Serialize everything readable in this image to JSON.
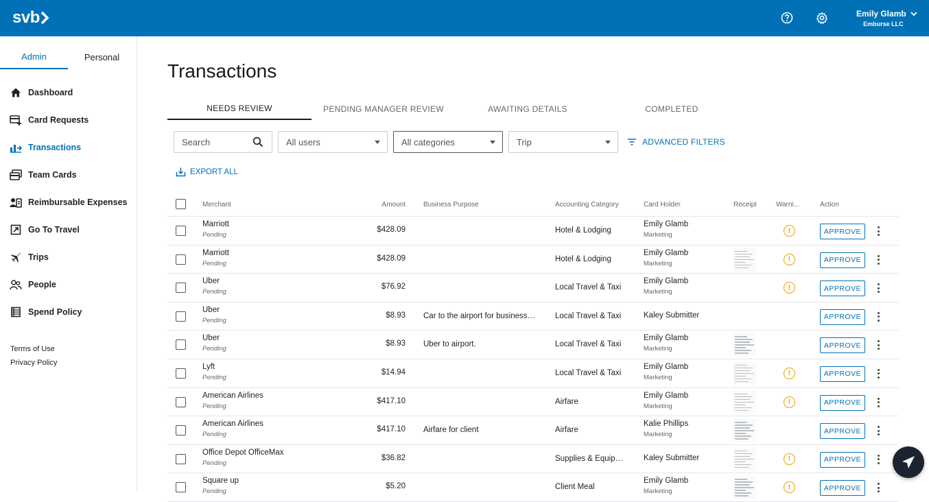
{
  "brand": {
    "logo": "svb",
    "primary": "#0071b7"
  },
  "header": {
    "user_name": "Emily Glamb",
    "org": "Emburse LLC"
  },
  "sidebar": {
    "tabs": [
      "Admin",
      "Personal"
    ],
    "items": [
      {
        "label": "Dashboard",
        "icon": "home-icon"
      },
      {
        "label": "Card Requests",
        "icon": "card-plus-icon"
      },
      {
        "label": "Transactions",
        "icon": "transactions-icon"
      },
      {
        "label": "Team Cards",
        "icon": "cards-icon"
      },
      {
        "label": "Reimbursable Expenses",
        "icon": "reimburse-icon"
      },
      {
        "label": "Go To Travel",
        "icon": "external-link-icon"
      },
      {
        "label": "Trips",
        "icon": "plane-icon"
      },
      {
        "label": "People",
        "icon": "people-icon"
      },
      {
        "label": "Spend Policy",
        "icon": "policy-icon"
      }
    ],
    "terms": "Terms of Use",
    "privacy": "Privacy Policy"
  },
  "page": {
    "title": "Transactions"
  },
  "tabs": [
    "NEEDS REVIEW",
    "PENDING MANAGER REVIEW",
    "AWAITING DETAILS",
    "COMPLETED"
  ],
  "filters": {
    "search_placeholder": "Search",
    "users": "All users",
    "categories": "All categories",
    "trip": "Trip",
    "advanced": "ADVANCED FILTERS"
  },
  "export_label": "EXPORT ALL",
  "columns": {
    "merchant": "Merchant",
    "amount": "Amount",
    "purpose": "Business Purpose",
    "category": "Accounting Category",
    "holder": "Card Holder",
    "receipt": "Receipt",
    "warnings": "Warni...",
    "action": "Action"
  },
  "approve_label": "APPROVE",
  "warn_symbol": "!",
  "rows": [
    {
      "merchant": "Marriott",
      "status": "Pending",
      "amount": "$428.09",
      "purpose": "",
      "category": "Hotel & Lodging",
      "holder": "Emily Glamb",
      "dept": "Marketing",
      "receipt": false,
      "warning": true
    },
    {
      "merchant": "Marriott",
      "status": "Pending",
      "amount": "$428.09",
      "purpose": "",
      "category": "Hotel & Lodging",
      "holder": "Emily Glamb",
      "dept": "Marketing",
      "receipt": true,
      "warning": true
    },
    {
      "merchant": "Uber",
      "status": "Pending",
      "amount": "$76.92",
      "purpose": "",
      "category": "Local Travel & Taxi",
      "holder": "Emily Glamb",
      "dept": "Marketing",
      "receipt": false,
      "warning": true
    },
    {
      "merchant": "Uber",
      "status": "Pending",
      "amount": "$8.93",
      "purpose": "Car to the airport for business ...",
      "category": "Local Travel & Taxi",
      "holder": "Kaley Submitter",
      "dept": "",
      "receipt": false,
      "warning": false
    },
    {
      "merchant": "Uber",
      "status": "Pending",
      "amount": "$8.93",
      "purpose": "Uber to airport.",
      "category": "Local Travel & Taxi",
      "holder": "Emily Glamb",
      "dept": "Marketing",
      "receipt": true,
      "warning": false
    },
    {
      "merchant": "Lyft",
      "status": "Pending",
      "amount": "$14.94",
      "purpose": "",
      "category": "Local Travel & Taxi",
      "holder": "Emily Glamb",
      "dept": "Marketing",
      "receipt": true,
      "warning": true
    },
    {
      "merchant": "American Airlines",
      "status": "Pending",
      "amount": "$417.10",
      "purpose": "",
      "category": "Airfare",
      "holder": "Emily Glamb",
      "dept": "Marketing",
      "receipt": true,
      "warning": true
    },
    {
      "merchant": "American Airlines",
      "status": "Pending",
      "amount": "$417.10",
      "purpose": "Airfare for client",
      "category": "Airfare",
      "holder": "Kalie Phillips",
      "dept": "Marketing",
      "receipt": true,
      "warning": false
    },
    {
      "merchant": "Office Depot OfficeMax",
      "status": "Pending",
      "amount": "$36.82",
      "purpose": "",
      "category": "Supplies & Equipm...",
      "holder": "Kaley Submitter",
      "dept": "",
      "receipt": true,
      "warning": true
    },
    {
      "merchant": "Square up",
      "status": "Pending",
      "amount": "$5.20",
      "purpose": "",
      "category": "Client Meal",
      "holder": "Emily Glamb",
      "dept": "Marketing",
      "receipt": true,
      "warning": true
    }
  ]
}
